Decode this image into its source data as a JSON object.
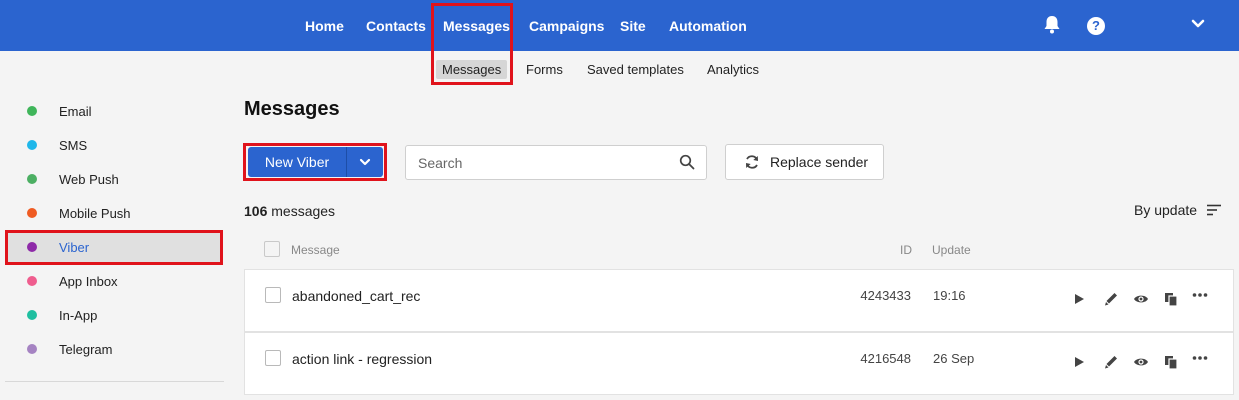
{
  "topnav": {
    "items": [
      "Home",
      "Contacts",
      "Messages",
      "Campaigns",
      "Site",
      "Automation"
    ],
    "help_label": "?"
  },
  "subnav": {
    "items": [
      "Messages",
      "Forms",
      "Saved templates",
      "Analytics"
    ]
  },
  "sidebar": {
    "items": [
      {
        "label": "Email",
        "color": "#3fb55a"
      },
      {
        "label": "SMS",
        "color": "#1fb7ea"
      },
      {
        "label": "Web Push",
        "color": "#4caf63"
      },
      {
        "label": "Mobile Push",
        "color": "#ef5b22"
      },
      {
        "label": "Viber",
        "color": "#8e2aa8"
      },
      {
        "label": "App Inbox",
        "color": "#ef5d8e"
      },
      {
        "label": "In-App",
        "color": "#1fbfa0"
      },
      {
        "label": "Telegram",
        "color": "#a583c2"
      }
    ]
  },
  "main": {
    "title": "Messages",
    "new_button": "New Viber",
    "search_placeholder": "Search",
    "replace_button": "Replace sender",
    "count_number": "106",
    "count_suffix": " messages",
    "sort_label": "By update",
    "columns": {
      "message": "Message",
      "id": "ID",
      "update": "Update"
    },
    "rows": [
      {
        "name": "abandoned_cart_rec",
        "id": "4243433",
        "update": "19:16"
      },
      {
        "name": "action link - regression",
        "id": "4216548",
        "update": "26 Sep"
      }
    ]
  },
  "colors": {
    "brand": "#2b64cf",
    "highlight": "#e0131b"
  }
}
